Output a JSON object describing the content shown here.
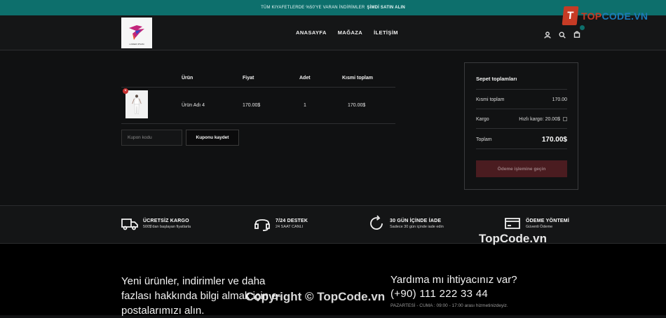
{
  "announcement": {
    "text": "TÜM KIYAFETLERDE %50'YE VARAN İNDİRİMLER",
    "cta": "ŞİMDİ SATIN ALIN"
  },
  "watermark": {
    "logo_letter": "T",
    "logo_text_a": "TOP",
    "logo_text_b": "CODE.VN",
    "center": "TopCode.vn",
    "copyright": "Copyright © TopCode.vn"
  },
  "logo": {
    "caption": "LOREM IPSUM"
  },
  "nav": [
    "ANASAYFA",
    "MAĞAZA",
    "İLETİŞİM"
  ],
  "cart": {
    "headers": {
      "product": "Ürün",
      "price": "Fiyat",
      "qty": "Adet",
      "subtotal": "Kısmi toplam"
    },
    "items": [
      {
        "name": "Ürün Adı 4",
        "price": "170.00$",
        "qty": "1",
        "subtotal": "170.00$"
      }
    ],
    "coupon_placeholder": "Kupon kodu",
    "coupon_button": "Kuponu kaydet"
  },
  "totals": {
    "title": "Sepet toplamları",
    "subtotal_label": "Kısmi toplam",
    "subtotal_value": "170.00",
    "shipping_label": "Kargo",
    "shipping_option": "Hızlı kargo: 20.00$",
    "total_label": "Toplam",
    "total_value": "170.00$",
    "checkout": "Ödeme işlemine geçin"
  },
  "features": [
    {
      "title": "ÜCRETSİZ KARGO",
      "sub": "500$'dan başlayan fiyatlarla"
    },
    {
      "title": "7/24 DESTEK",
      "sub": "24 SAAT CANLI"
    },
    {
      "title": "30 GÜN İÇİNDE İADE",
      "sub": "Sadece 30 gün içinde iade edin"
    },
    {
      "title": "ÖDEME YÖNTEMİ",
      "sub": "Güvenli Ödeme"
    }
  ],
  "footer": {
    "newsletter": "Yeni ürünler, indirimler ve daha fazlası hakkında bilgi almak için e-postalarımızı alın.",
    "help_title": "Yardıma mı ihtiyacınız var?",
    "phone": "(+90) 111 222 33 44",
    "hours": "PAZARTESİ - CUMA : 09:00 - 17:00 arası hizmetinizdeyiz."
  },
  "colors": {
    "accent": "#0d6f6c",
    "checkout_bg": "#4a1c20",
    "remove": "#c62f2f"
  }
}
